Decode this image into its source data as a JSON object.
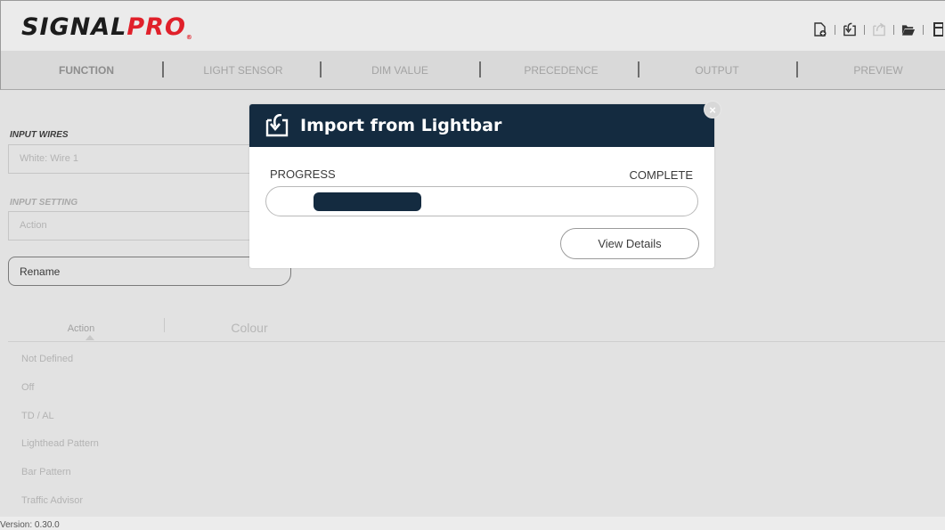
{
  "app": {
    "logo_part1": "SIGNAL",
    "logo_part2": "PRO",
    "logo_reg": "®",
    "version": "Version: 0.30.0"
  },
  "toolbar": {
    "icons": [
      "new-file-icon",
      "import-icon",
      "export-icon",
      "open-folder-icon",
      "save-icon"
    ]
  },
  "tabs": [
    "FUNCTION",
    "LIGHT SENSOR",
    "DIM VALUE",
    "PRECEDENCE",
    "OUTPUT",
    "PREVIEW"
  ],
  "active_tab": "FUNCTION",
  "left_panel": {
    "input_wires_label": "INPUT WIRES",
    "input_wires_value": "White:  Wire 1",
    "input_setting_label": "INPUT SETTING",
    "input_setting_value": "Action",
    "rename_label": "Rename",
    "subtabs": [
      "Action",
      "Colour"
    ],
    "action_items": [
      "Not Defined",
      "Off",
      "TD / AL",
      "Lighthead Pattern",
      "Bar Pattern",
      "Traffic Advisor"
    ]
  },
  "modal": {
    "title": "Import from Lightbar",
    "progress_label": "PROGRESS",
    "status_label": "COMPLETE",
    "progress_start": 0.11,
    "progress_end": 0.36,
    "details_button": "View Details",
    "close_glyph": "×"
  },
  "colors": {
    "brand_dark": "#142b40",
    "brand_red": "#e0202a"
  }
}
